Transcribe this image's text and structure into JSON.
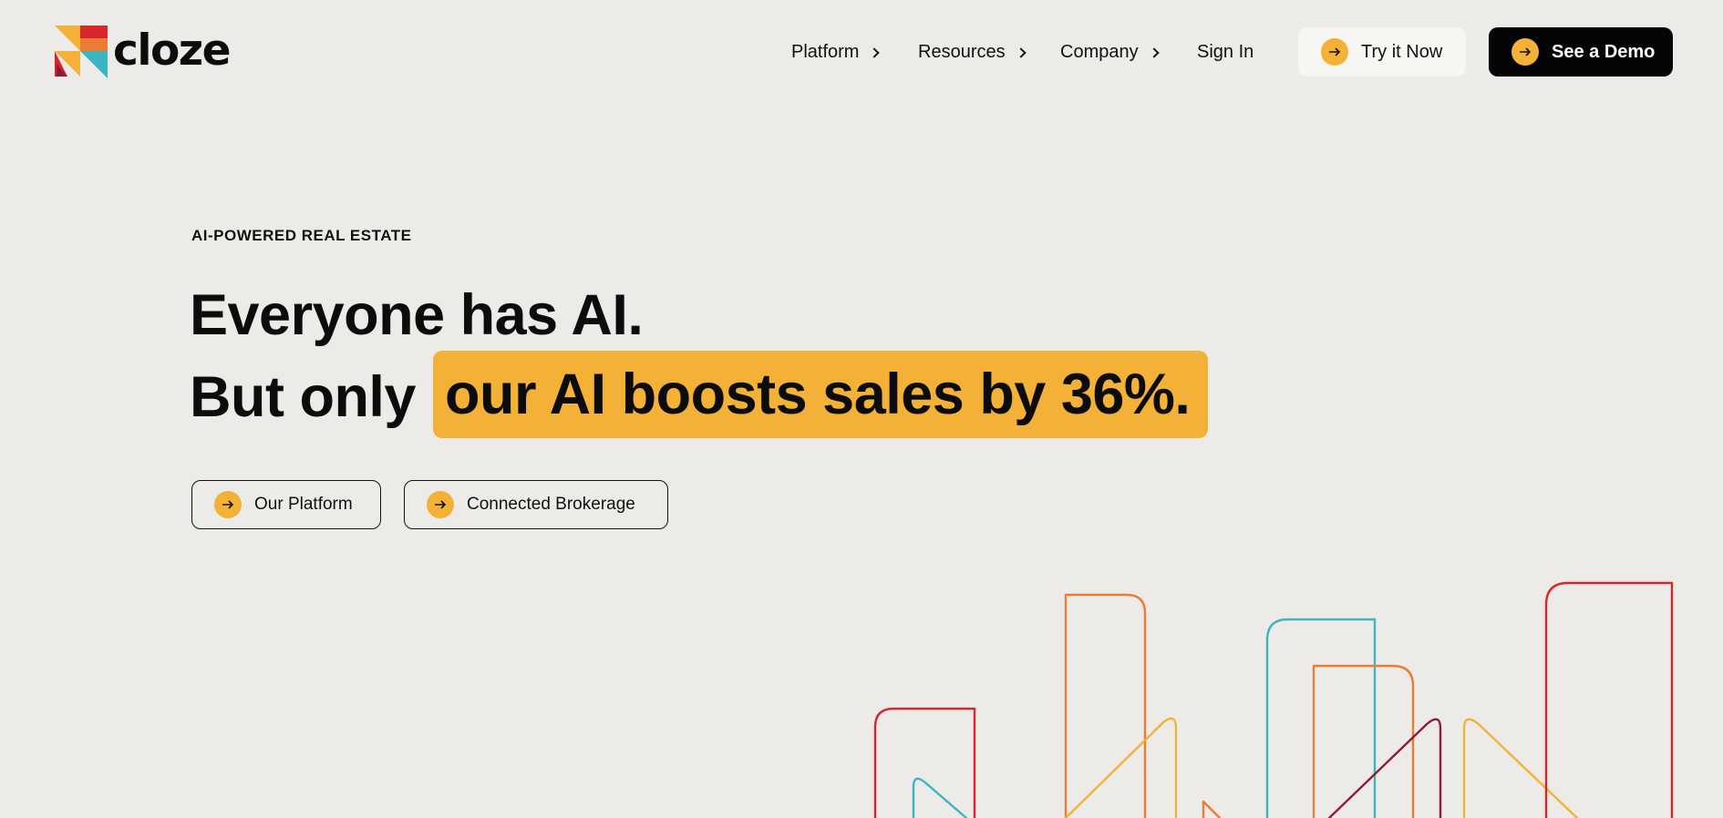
{
  "brand": {
    "name": "cloze",
    "logo_icon": "cloze-logo-mark",
    "colors": {
      "red": "#d8262d",
      "orange": "#ec7b34",
      "yellow": "#f3b237",
      "teal": "#3bb6c1",
      "maroon": "#8f1b33"
    }
  },
  "nav": {
    "items": [
      {
        "label": "Platform",
        "icon": "chevron-right-icon"
      },
      {
        "label": "Resources",
        "icon": "chevron-right-icon"
      },
      {
        "label": "Company",
        "icon": "chevron-right-icon"
      },
      {
        "label": "Sign In"
      }
    ],
    "try_label": "Try it Now",
    "demo_label": "See a Demo"
  },
  "hero": {
    "eyebrow": "AI-POWERED REAL ESTATE",
    "line1": "Everyone has AI.",
    "line2_prefix": "But only",
    "line2_highlight": "our AI boosts sales by 36%.",
    "highlight_color": "#f3b237",
    "buttons": [
      {
        "label": "Our Platform",
        "icon": "arrow-right-icon"
      },
      {
        "label": "Connected Brokerage",
        "icon": "arrow-right-icon"
      }
    ]
  },
  "illustration": {
    "name": "skyline-outline-illustration"
  }
}
